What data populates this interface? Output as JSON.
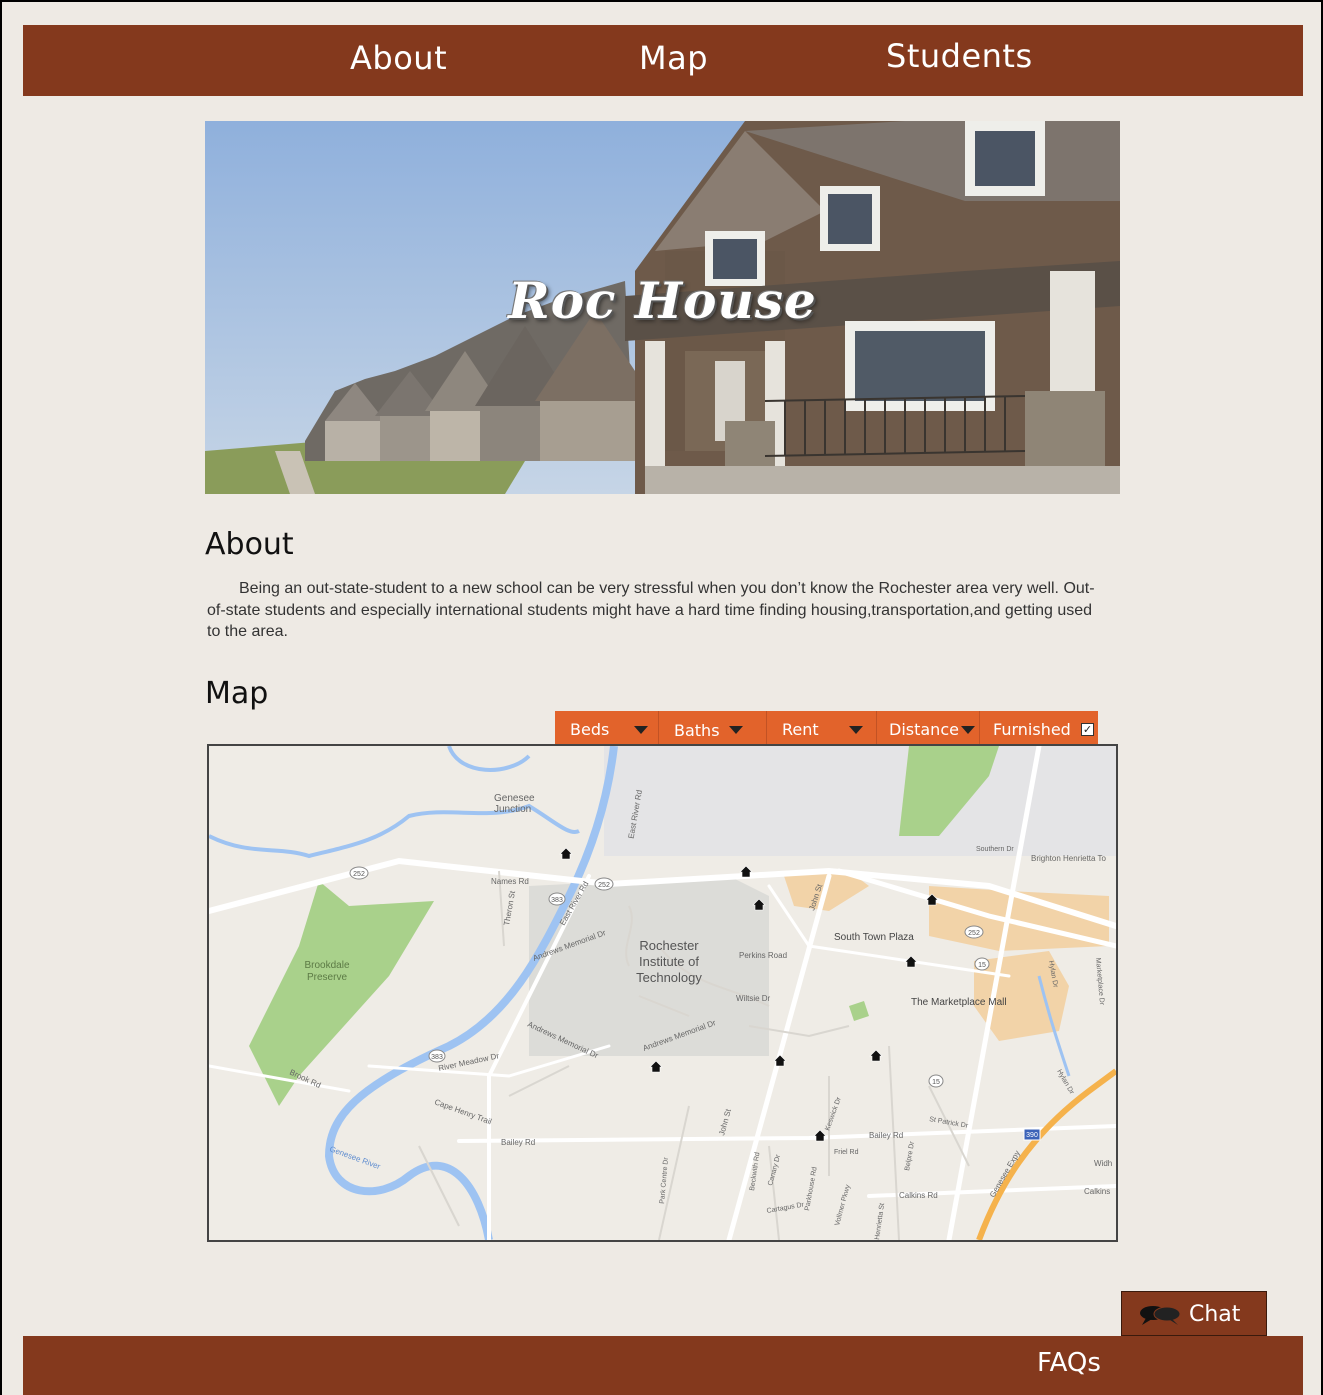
{
  "nav": {
    "about": "About",
    "map": "Map",
    "students": "Students"
  },
  "hero": {
    "title": "Roc House"
  },
  "about": {
    "heading": "About",
    "text": "Being an out-state-student to a new school can be very stressful when you don’t know the Rochester area very well. Out-of-state students and especially international students might have a hard time finding housing,transportation,and getting used to the area."
  },
  "map_section": {
    "heading": "Map",
    "filters": [
      {
        "label": "Beds",
        "icon": "chevron-down-icon"
      },
      {
        "label": "Baths",
        "icon": "chevron-down-icon"
      },
      {
        "label": "Rent",
        "icon": "chevron-down-icon"
      },
      {
        "label": "Distance",
        "icon": "chevron-down-icon"
      },
      {
        "label": "Furnished",
        "icon": "checkbox-icon",
        "checked": true
      }
    ],
    "labels": {
      "genesee_junction": "Genesee\nJunction",
      "east_river_rd": "East River Rd",
      "names_rd": "Names Rd",
      "theron_st": "Theron St",
      "andrews_memorial": "Andrews Memorial Dr",
      "rit": "Rochester\nInstitute of\nTechnology",
      "perkins_road": "Perkins Road",
      "wiltsie_dr": "Wiltsie Dr",
      "john_st": "John St",
      "south_town_plaza": "South Town Plaza",
      "marketplace_mall": "The Marketplace Mall",
      "brookdale": "Brookdale\nPreserve",
      "brook_rd": "Brook Rd",
      "river_meadow": "River Meadow Dr",
      "cape_henry": "Cape Henry Trail",
      "bailey_rd": "Bailey Rd",
      "bailey_rd_east": "Bailey Rd",
      "genesee_river": "Genesee River",
      "southern_dr": "Southern Dr",
      "brighton_henrietta": "Brighton Henrietta To",
      "st_patrick": "St Patrick Dr",
      "calkins_rd": "Calkins Rd",
      "calkins_east": "Calkins",
      "genesee_expy": "Genesee Expy",
      "hylan_dr": "Hylan Dr",
      "marketplace_dr": "Marketplace Dr",
      "park_centre": "Park Centre Dr",
      "beckwith": "Beckwith Rd",
      "canary": "Canary Dr",
      "parkhouse": "Parkhouse Rd",
      "volmer": "Vollmer Pkwy",
      "henrietta": "Henrietta St",
      "keswick": "Keswick Dr",
      "friel": "Friel Rd",
      "belpre": "Belpre Dr",
      "cartagus": "Cartagus Dr",
      "widh": "Widh",
      "shield_252a": "252",
      "shield_252b": "252",
      "shield_252c": "252",
      "shield_383a": "383",
      "shield_383b": "383",
      "shield_15a": "15",
      "shield_15b": "15",
      "shield_390": "390"
    }
  },
  "chat": {
    "label": "Chat",
    "icon": "chat-bubbles-icon"
  },
  "footer": {
    "faqs": "FAQs"
  },
  "colors": {
    "brand_brown": "#84391d",
    "filter_orange": "#e2632b",
    "page_bg": "#eeeae4"
  }
}
